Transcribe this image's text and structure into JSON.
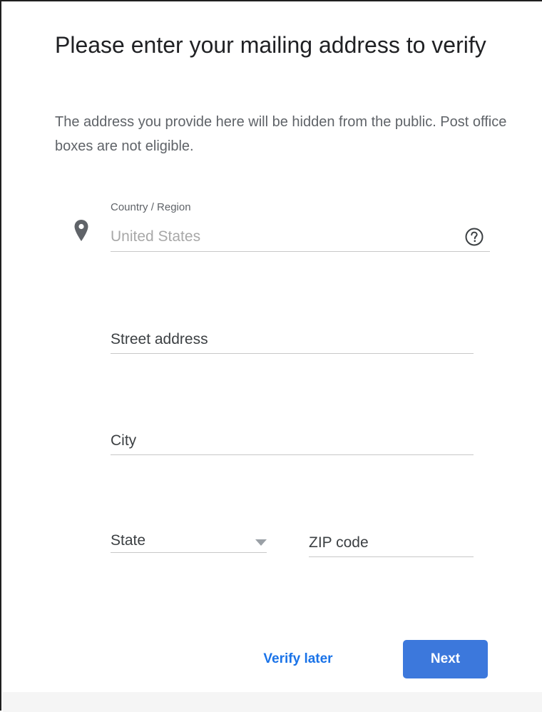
{
  "header": {
    "title": "Please enter your mailing address to verify",
    "subtitle": "The address you provide here will be hidden from the public. Post office boxes are not eligible."
  },
  "form": {
    "country": {
      "label": "Country / Region",
      "value": "United States",
      "icon": "location-pin-icon",
      "help_icon": "help-circle-icon"
    },
    "street": {
      "placeholder": "Street address",
      "value": ""
    },
    "city": {
      "placeholder": "City",
      "value": ""
    },
    "state": {
      "placeholder": "State",
      "icon": "chevron-down-icon"
    },
    "zip": {
      "placeholder": "ZIP code",
      "value": ""
    }
  },
  "actions": {
    "verify_later_label": "Verify later",
    "next_label": "Next"
  },
  "colors": {
    "accent": "#1a73e8",
    "primary_button": "#3c78dc",
    "title_text": "#202124",
    "secondary_text": "#5f6368",
    "disabled_text": "#a8a8a8",
    "underline": "#c8c8c8"
  }
}
